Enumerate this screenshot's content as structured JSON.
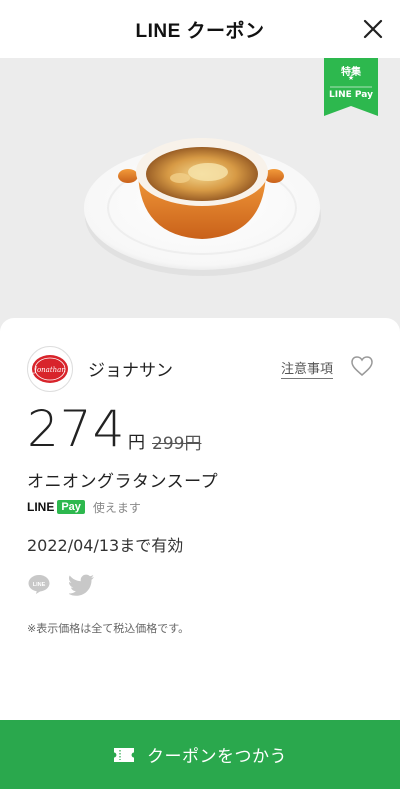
{
  "header": {
    "title": "LINE クーポン"
  },
  "badge": {
    "top": "特集",
    "star": "★",
    "bottom": "LINE Pay"
  },
  "shop": {
    "name": "ジョナサン",
    "logo_text": "Jonathan's"
  },
  "notice_label": "注意事項",
  "price": {
    "current": "274",
    "yen": "円",
    "original": "299円"
  },
  "product": {
    "name": "オニオングラタンスープ"
  },
  "payment": {
    "line": "LINE",
    "pay": "Pay",
    "text": "使えます"
  },
  "validity": "2022/04/13まで有効",
  "share": {
    "line_icon": "line-share-icon",
    "twitter_icon": "twitter-icon"
  },
  "tax_note": "※表示価格は全て税込価格です。",
  "cta": {
    "label": "クーポンをつかう"
  },
  "colors": {
    "accent": "#2aa84d",
    "badge": "#2db84e",
    "hero_bg": "#ececec"
  }
}
